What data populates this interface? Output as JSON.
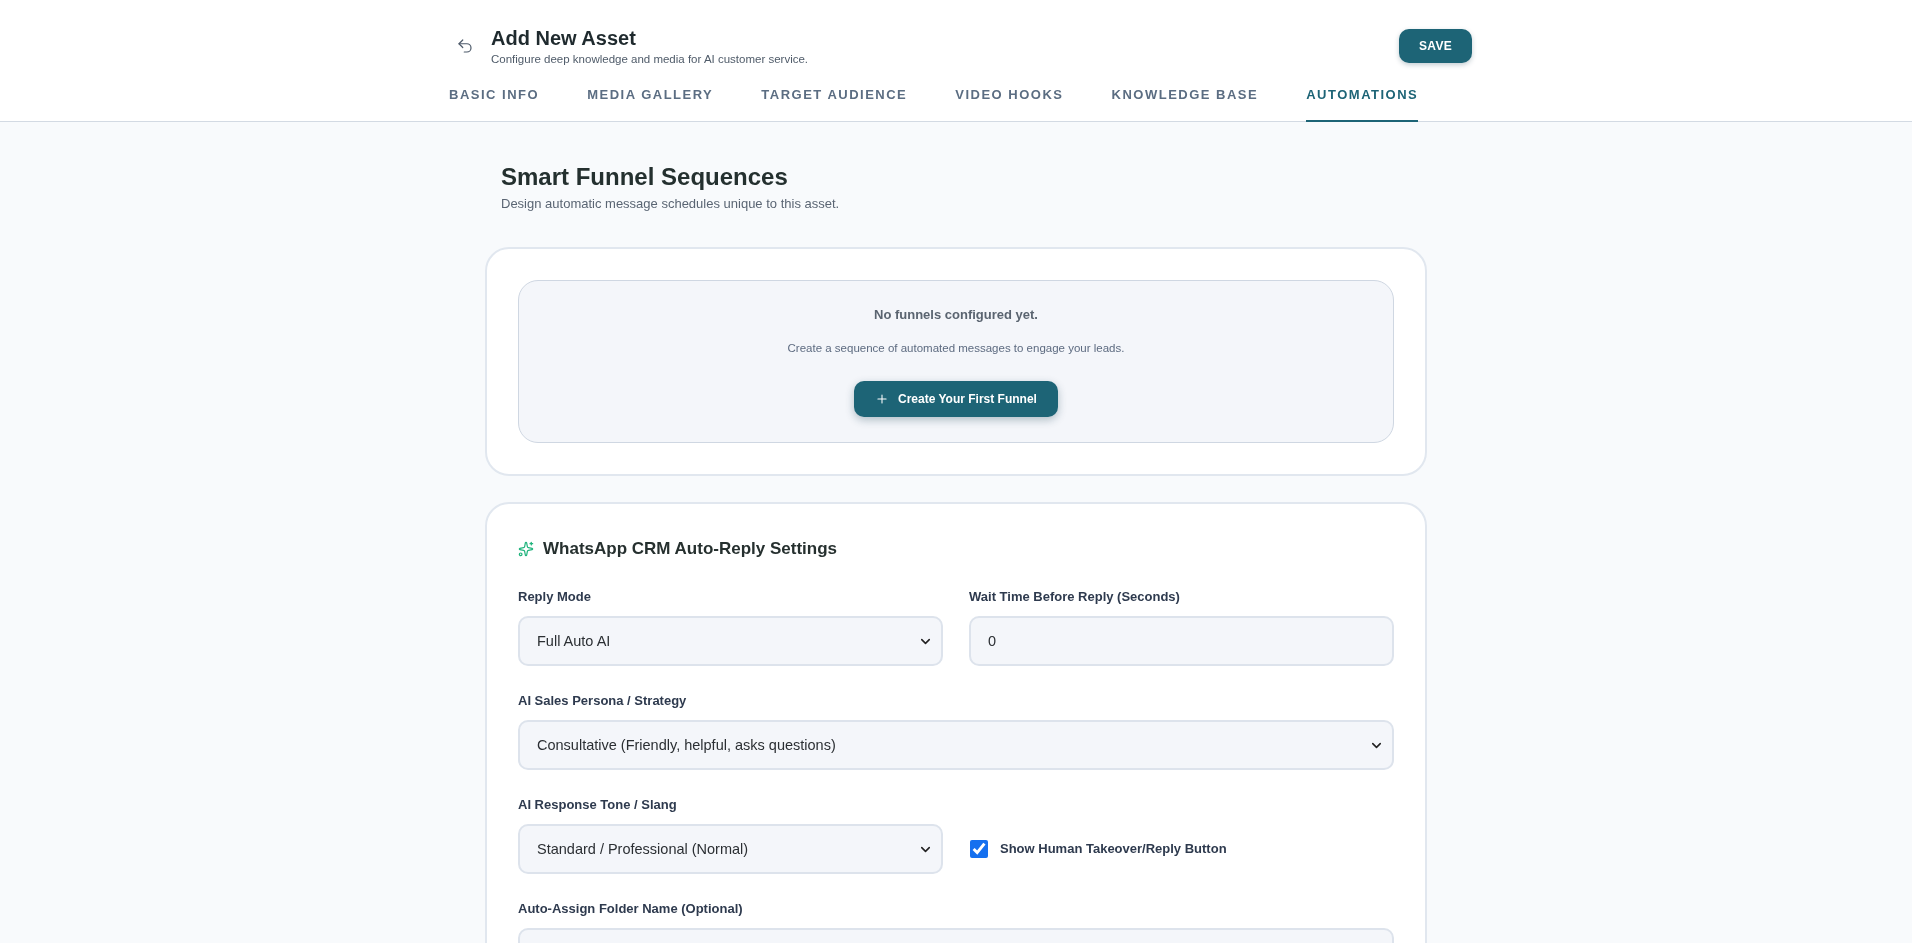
{
  "header": {
    "title": "Add New Asset",
    "subtitle": "Configure deep knowledge and media for AI customer service.",
    "save_button": "SAVE"
  },
  "tabs": [
    {
      "label": "BASIC INFO",
      "selected": false
    },
    {
      "label": "MEDIA GALLERY",
      "selected": false
    },
    {
      "label": "TARGET AUDIENCE",
      "selected": false
    },
    {
      "label": "VIDEO HOOKS",
      "selected": false
    },
    {
      "label": "KNOWLEDGE BASE",
      "selected": false
    },
    {
      "label": "AUTOMATIONS",
      "selected": true
    }
  ],
  "section": {
    "title": "Smart Funnel Sequences",
    "subtitle": "Design automatic message schedules unique to this asset."
  },
  "funnels_empty": {
    "title": "No funnels configured yet.",
    "message": "Create a sequence of automated messages to engage your leads.",
    "button": "Create Your First Funnel"
  },
  "auto_reply": {
    "title": "WhatsApp CRM Auto-Reply Settings",
    "rows": [
      {
        "fields": [
          {
            "kind": "select",
            "label": "Reply Mode",
            "value": "Full Auto AI"
          },
          {
            "kind": "input",
            "label": "Wait Time Before Reply (Seconds)",
            "value": "0"
          }
        ]
      },
      {
        "fields": [
          {
            "kind": "select",
            "label": "AI Sales Persona / Strategy",
            "value": "Consultative (Friendly, helpful, asks questions)"
          }
        ]
      },
      {
        "fields": [
          {
            "kind": "select",
            "label": "AI Response Tone / Slang",
            "value": "Standard / Professional (Normal)"
          },
          {
            "kind": "checkbox",
            "label": "Show Human Takeover/Reply Button",
            "checked": true
          }
        ]
      },
      {
        "fields": [
          {
            "kind": "input",
            "label": "Auto-Assign Folder Name (Optional)"
          }
        ]
      }
    ]
  }
}
